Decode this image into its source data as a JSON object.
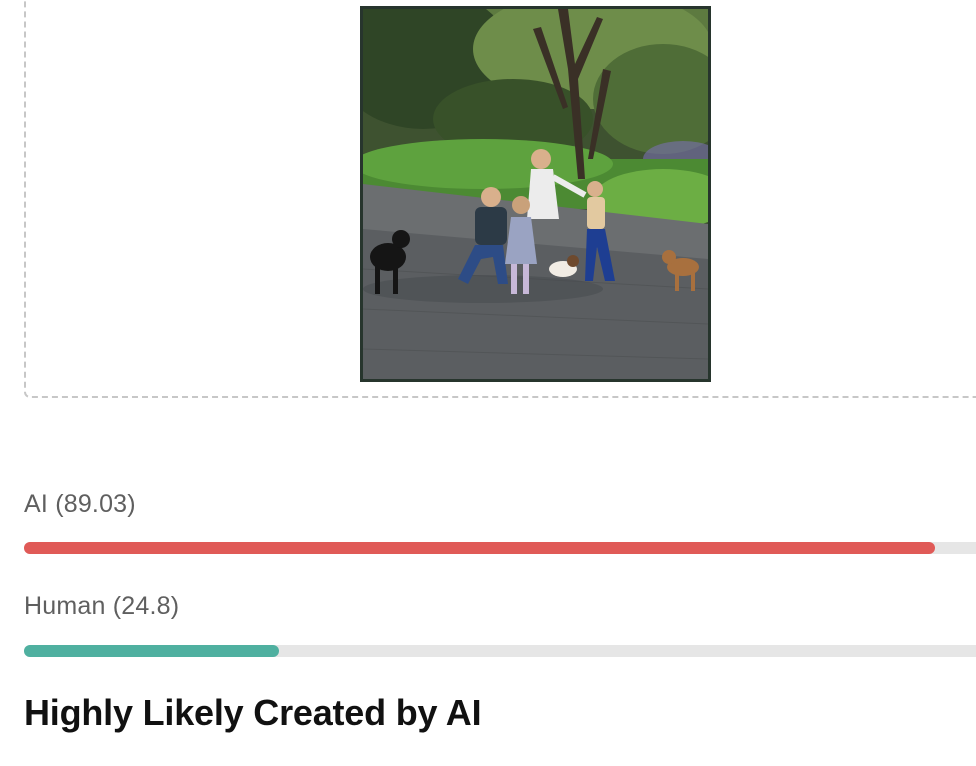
{
  "image_alt": "Uploaded photo: family with children and dogs on a garden path",
  "scores": [
    {
      "name": "AI",
      "value_text": "(89.03)",
      "value": 89.03,
      "fraction": 0.93,
      "color": "#e05a57"
    },
    {
      "name": "Human",
      "value_text": "(24.8)",
      "value": 24.8,
      "fraction": 0.26,
      "color": "#4fb0a0"
    }
  ],
  "verdict": "Highly Likely Created by AI"
}
